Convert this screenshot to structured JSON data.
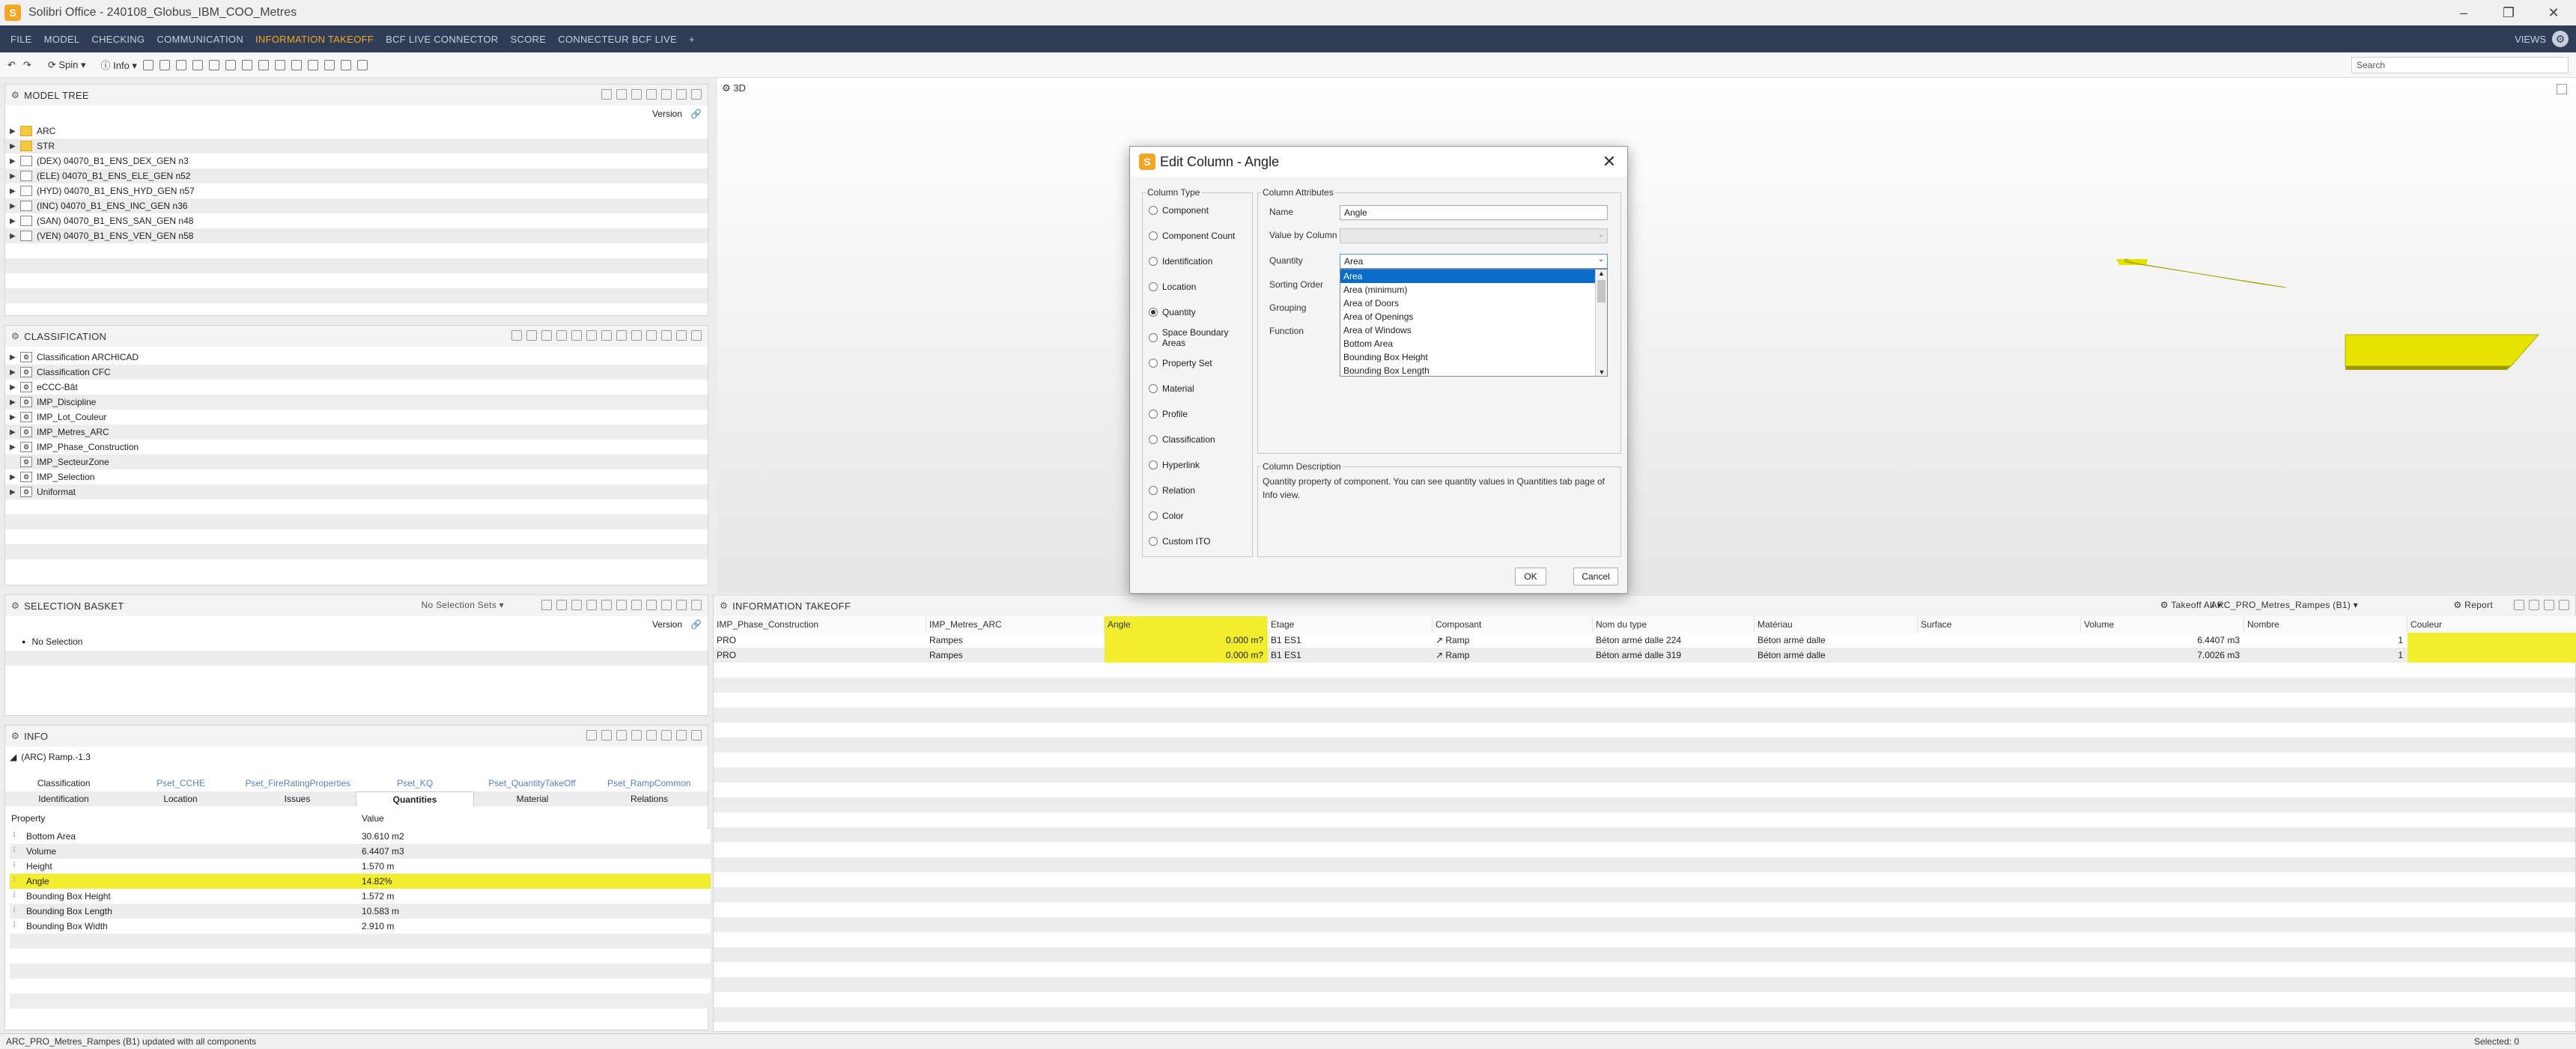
{
  "app": {
    "title": "Solibri Office - 240108_Globus_IBM_COO_Metres",
    "logo_letter": "S"
  },
  "menu": [
    "FILE",
    "MODEL",
    "CHECKING",
    "COMMUNICATION",
    "INFORMATION TAKEOFF",
    "BCF LIVE CONNECTOR",
    "SCORE",
    "CONNECTEUR BCF LIVE",
    "+"
  ],
  "menu_active": "INFORMATION TAKEOFF",
  "menu_views": "VIEWS",
  "toolbar": {
    "spin": "Spin",
    "info": "Info",
    "search_placeholder": "Search"
  },
  "model_tree": {
    "title": "MODEL TREE",
    "version_label": "Version",
    "items": [
      {
        "label": "ARC",
        "icon": "folder-icon"
      },
      {
        "label": "STR",
        "icon": "folder-icon"
      },
      {
        "label": "(DEX) 04070_B1_ENS_DEX_GEN n3",
        "icon": "model-icon"
      },
      {
        "label": "(ELE) 04070_B1_ENS_ELE_GEN n52",
        "icon": "model-icon"
      },
      {
        "label": "(HYD) 04070_B1_ENS_HYD_GEN n57",
        "icon": "model-icon"
      },
      {
        "label": "(INC) 04070_B1_ENS_INC_GEN n36",
        "icon": "model-icon"
      },
      {
        "label": "(SAN) 04070_B1_ENS_SAN_GEN n48",
        "icon": "model-icon"
      },
      {
        "label": "(VEN) 04070_B1_ENS_VEN_GEN n58",
        "icon": "model-icon"
      }
    ]
  },
  "classification": {
    "title": "CLASSIFICATION",
    "items": [
      "Classification ARCHICAD",
      "Classification CFC",
      "eCCC-Bât",
      "IMP_Discipline",
      "IMP_Lot_Couleur",
      "IMP_Metres_ARC",
      "IMP_Phase_Construction",
      "IMP_SecteurZone",
      "IMP_Selection",
      "Uniformat"
    ]
  },
  "selection_basket": {
    "title": "SELECTION BASKET",
    "sets_label": "No Selection Sets",
    "version_label": "Version",
    "empty": "No Selection"
  },
  "info": {
    "title": "INFO",
    "object": "(ARC) Ramp.-1.3",
    "tabs_row1": [
      "Classification",
      "Pset_CCHE",
      "Pset_FireRatingProperties",
      "Pset_KQ",
      "Pset_QuantityTakeOff",
      "Pset_RampCommon"
    ],
    "tabs_row2": [
      "Identification",
      "Location",
      "Issues",
      "Quantities",
      "Material",
      "Relations"
    ],
    "active_tab": "Quantities",
    "col_property": "Property",
    "col_value": "Value",
    "rows": [
      {
        "property": "Bottom Area",
        "value": "30.610 m2"
      },
      {
        "property": "Volume",
        "value": "6.4407 m3"
      },
      {
        "property": "Height",
        "value": "1.570 m"
      },
      {
        "property": "Angle",
        "value": "14.82%"
      },
      {
        "property": "Bounding Box Height",
        "value": "1.572 m"
      },
      {
        "property": "Bounding Box Length",
        "value": "10.583 m"
      },
      {
        "property": "Bounding Box Width",
        "value": "2.910 m"
      }
    ],
    "highlight_row": "Angle"
  },
  "view3d": {
    "label": "3D"
  },
  "dialog": {
    "title": "Edit Column - Angle",
    "column_type_label": "Column Type",
    "column_types": [
      "Component",
      "Component Count",
      "Identification",
      "Location",
      "Quantity",
      "Space Boundary Areas",
      "Property Set",
      "Material",
      "Profile",
      "Classification",
      "Hyperlink",
      "Relation",
      "Color",
      "Custom ITO"
    ],
    "selected_type": "Quantity",
    "column_attributes_label": "Column Attributes",
    "name_label": "Name",
    "name_value": "Angle",
    "value_by_column_label": "Value by Column",
    "quantity_label": "Quantity",
    "quantity_value": "Area",
    "sorting_order_label": "Sorting Order",
    "grouping_label": "Grouping",
    "function_label": "Function",
    "dropdown_options": [
      "Area",
      "Area (minimum)",
      "Area of Doors",
      "Area of Openings",
      "Area of Windows",
      "Bottom Area",
      "Bounding Box Height",
      "Bounding Box Length"
    ],
    "dropdown_selected": "Area",
    "description_label": "Column Description",
    "description": "Quantity property of component. You can see quantity values in Quantities tab page of Info view.",
    "ok": "OK",
    "cancel": "Cancel"
  },
  "takeoff": {
    "title": "INFORMATION TAKEOFF",
    "takeoff_all": "Takeoff All",
    "ito_name": "ARC_PRO_Metres_Rampes (B1)",
    "report": "Report",
    "columns": [
      "IMP_Phase_Construction",
      "IMP_Metres_ARC",
      "Angle",
      "Etage",
      "Composant",
      "Nom du type",
      "Matériau",
      "Surface",
      "Volume",
      "Nombre",
      "Couleur"
    ],
    "rows": [
      {
        "phase": "PRO",
        "metres": "Rampes",
        "angle": "0.000 m?",
        "etage": "B1 ES1",
        "composant": "Ramp",
        "type": "Béton armé dalle 224",
        "materiau": "Béton armé dalle",
        "surface": "",
        "volume": "6.4407 m3",
        "nombre": "1",
        "couleur": ""
      },
      {
        "phase": "PRO",
        "metres": "Rampes",
        "angle": "0.000 m?",
        "etage": "B1 ES1",
        "composant": "Ramp",
        "type": "Béton armé dalle 319",
        "materiau": "Béton armé dalle",
        "surface": "",
        "volume": "7.0026 m3",
        "nombre": "1",
        "couleur": ""
      }
    ]
  },
  "status": {
    "message": "ARC_PRO_Metres_Rampes (B1) updated with all components",
    "selected": "Selected: 0"
  },
  "colors": {
    "accent": "#f5a623",
    "menubar": "#2f3e56",
    "highlight": "#f2ee2e",
    "selection": "#0a6cc9"
  }
}
